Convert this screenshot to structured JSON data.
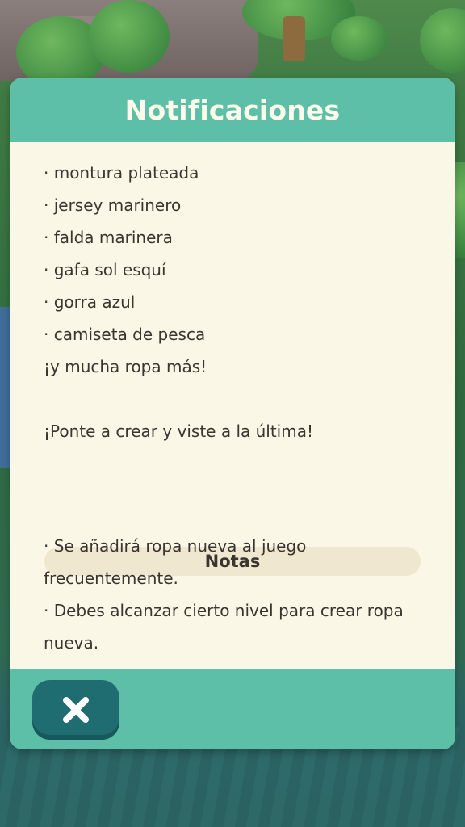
{
  "dialog": {
    "title": "Notificaciones",
    "items": [
      "· montura plateada",
      "· jersey marinero",
      "· falda marinera",
      "· gafa sol esquí",
      "· gorra azul",
      "· camiseta de pesca",
      "¡y mucha ropa más!"
    ],
    "call_to_action": "¡Ponte a crear y viste a la última!",
    "notes": {
      "label": "Notas",
      "lines": [
        "· Se añadirá ropa nueva al juego",
        "frecuentemente.",
        "· Debes alcanzar cierto nivel para crear ropa",
        "nueva."
      ]
    },
    "close_icon": "close-icon"
  },
  "colors": {
    "header": "#5dbfa8",
    "panel": "#fbf7e6",
    "notes_bar": "#efe7cf",
    "close_button": "#1f6d70"
  }
}
